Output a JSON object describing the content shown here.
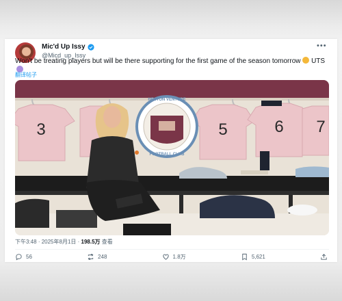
{
  "author": {
    "name": "Mic'd Up Issy",
    "handle": "@Micd_up_Issy",
    "verified": true,
    "avatar_icon": "avatar-photo"
  },
  "tweet": {
    "text": "Won't be treating players but will be there supporting for the first game of the season tomorrow",
    "text_tail": "UTS",
    "translate_label": "翻译帖子"
  },
  "photo": {
    "crest_top": "HESTON VENTURE",
    "crest_bottom": "FOOTBALL CLUB",
    "shirt_numbers": [
      "3",
      "5",
      "6",
      "7"
    ]
  },
  "meta": {
    "time": "下午3:48",
    "date": "2025年8月1日",
    "views": "198.5万",
    "views_label": "查看"
  },
  "actions": {
    "replies": "56",
    "reposts": "248",
    "likes": "1.8万",
    "bookmarks": "5,621"
  },
  "colors": {
    "accent": "#1d9bf0",
    "verified": "#1d9bf0",
    "wall_maroon": "#7a3548"
  }
}
